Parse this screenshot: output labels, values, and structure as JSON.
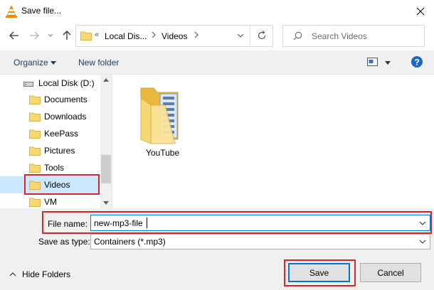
{
  "window": {
    "title": "Save file..."
  },
  "nav": {
    "address_parts": [
      "Local Dis...",
      "Videos"
    ],
    "search_placeholder": "Search Videos"
  },
  "toolbar": {
    "organize_label": "Organize",
    "new_folder_label": "New folder"
  },
  "tree": {
    "items": [
      {
        "label": "Local Disk (D:)"
      },
      {
        "label": "Documents"
      },
      {
        "label": "Downloads"
      },
      {
        "label": "KeePass"
      },
      {
        "label": "Pictures"
      },
      {
        "label": "Tools"
      },
      {
        "label": "Videos",
        "selected": true
      },
      {
        "label": "VM"
      }
    ]
  },
  "files": [
    {
      "name": "YouTube"
    }
  ],
  "form": {
    "file_name_label": "File name:",
    "file_name_value": "new-mp3-file",
    "save_type_label": "Save as type:",
    "save_type_value": "Containers (*.mp3)"
  },
  "footer": {
    "hide_folders_label": "Hide Folders",
    "save_label": "Save",
    "cancel_label": "Cancel"
  },
  "colors": {
    "accent": "#0078d7",
    "highlight": "#d9242b",
    "folder": "#f8d775",
    "selection": "#cce8ff"
  }
}
